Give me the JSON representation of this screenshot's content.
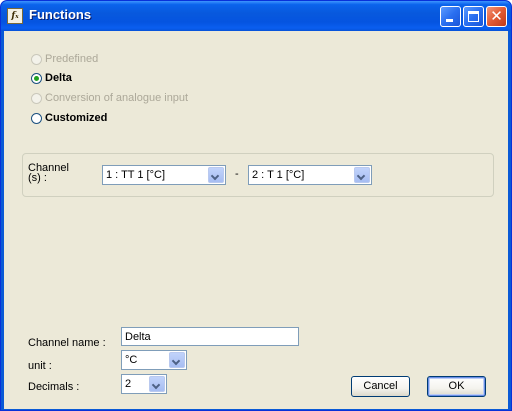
{
  "window": {
    "title": "Functions",
    "app_icon_text": "fₓ"
  },
  "function_types": [
    {
      "label": "Predefined",
      "enabled": false,
      "checked": false,
      "bold": false
    },
    {
      "label": "Delta",
      "enabled": true,
      "checked": true,
      "bold": true
    },
    {
      "label": "Conversion of analogue input",
      "enabled": false,
      "checked": false,
      "bold": false
    },
    {
      "label": "Customized",
      "enabled": true,
      "checked": false,
      "bold": true
    }
  ],
  "channels": {
    "label_line1": "Channel",
    "label_line2": "(s) :",
    "first_channel": "1 : TT 1 [°C]",
    "separator": "-",
    "second_channel": "2 : T 1 [°C]"
  },
  "fields": {
    "channel_name_label": "Channel name :",
    "channel_name_value": "Delta",
    "unit_label": "unit :",
    "unit_value": "°C",
    "decimals_label": "Decimals :",
    "decimals_value": "2"
  },
  "buttons": {
    "cancel": "Cancel",
    "ok": "OK"
  }
}
